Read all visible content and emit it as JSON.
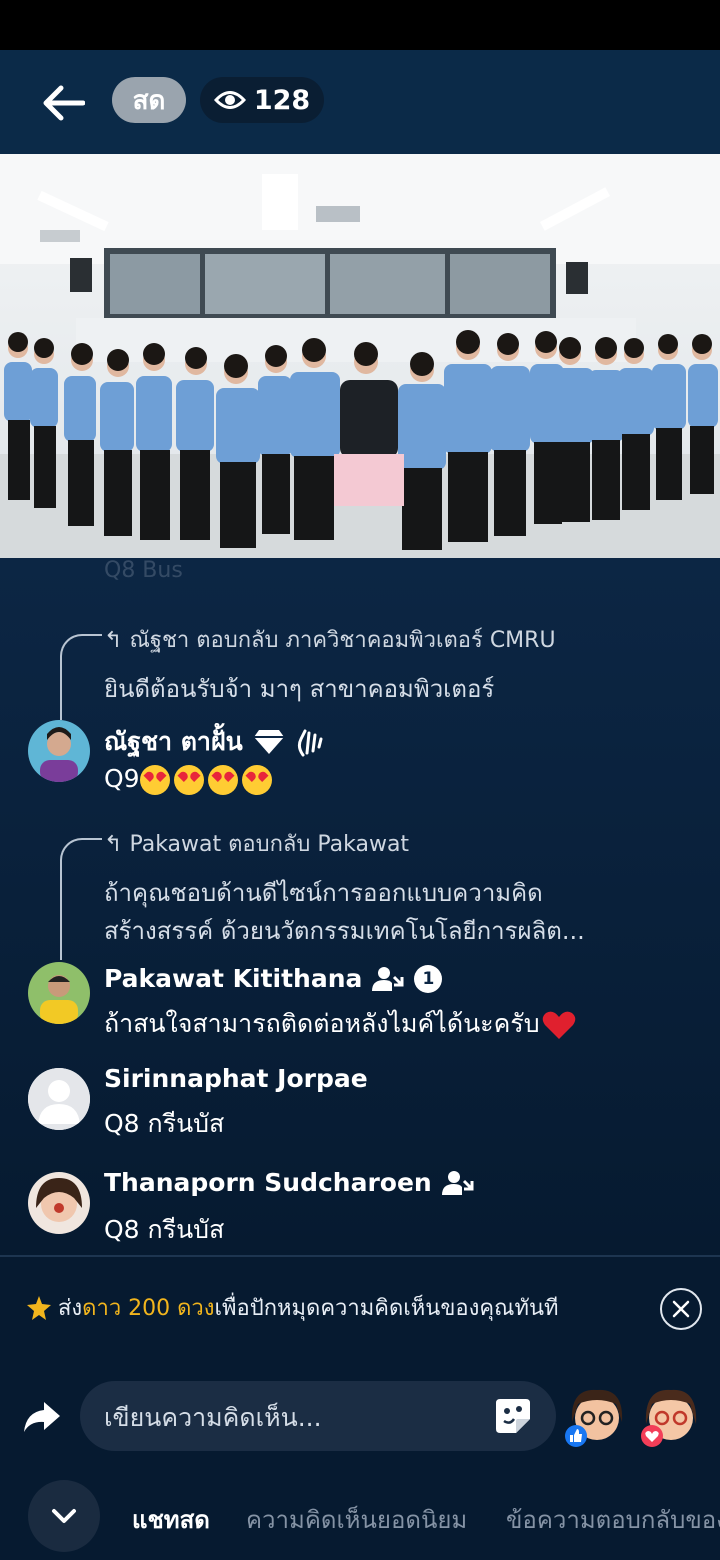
{
  "header": {
    "live_label": "สด",
    "viewer_count": "128"
  },
  "chat": {
    "faded_previous": "Q8 Bus",
    "comments": [
      {
        "reply_header": "ณัฐชา ตอบกลับ ภาควิชาคอมพิวเตอร์ CMRU",
        "reply_text": [
          "ยินดีต้อนรับจ้า มาๆ สาขาคอมพิวเตอร์"
        ],
        "author": "ณัฐชา ตาฝั้น",
        "message": "Q9"
      },
      {
        "reply_header": "Pakawat ตอบกลับ Pakawat",
        "reply_text": [
          "ถ้าคุณชอบด้านดีไซน์การออกแบบความคิด",
          "สร้างสรรค์ ด้วยนวัตกรรมเทคโนโลยีการผลิต..."
        ],
        "author": "Pakawat Kitithana",
        "badge_number": "1",
        "message": "ถ้าสนใจสามารถติดต่อหลังไมค์ได้นะครับ"
      },
      {
        "author": "Sirinnaphat Jorpae",
        "message": "Q8 กรีนบัส"
      },
      {
        "author": "Thanaporn Sudcharoen",
        "message": "Q8 กรีนบัส"
      }
    ]
  },
  "stars_banner": {
    "prefix": "ส่ง",
    "highlight": "ดาว 200 ดวง",
    "suffix": "เพื่อปักหมุดความคิดเห็นของคุณทันที"
  },
  "composer": {
    "placeholder": "เขียนความคิดเห็น..."
  },
  "tabs": [
    "แชทสด",
    "ความคิดเห็นยอดนิยม",
    "ข้อความตอบกลับของ"
  ],
  "colors": {
    "background": "#061a30",
    "header": "#0b2a48",
    "star_accent": "#f2b51d",
    "like_blue": "#1877f2",
    "love_red": "#f33e58"
  },
  "icons": [
    "back-arrow-icon",
    "eye-icon",
    "diamond-icon",
    "wave-icon",
    "fan-icon",
    "star-icon",
    "close-icon",
    "share-icon",
    "sticker-icon",
    "chevron-down-icon",
    "like-icon",
    "love-icon"
  ]
}
